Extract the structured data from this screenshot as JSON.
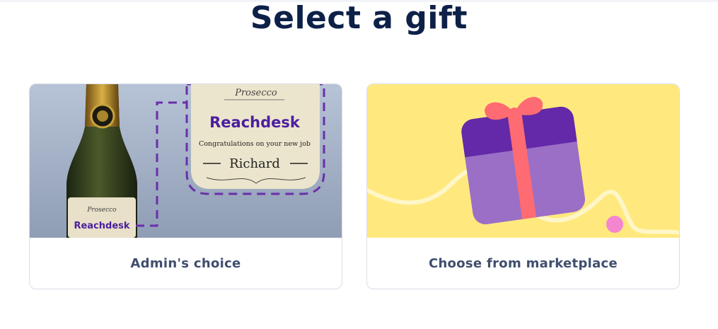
{
  "page": {
    "title": "Select a gift"
  },
  "cards": [
    {
      "label": "Admin's choice",
      "image": {
        "brand": "Reachdesk",
        "wine": "Prosecco",
        "message": "Congratulations on your new job",
        "name": "Richard"
      }
    },
    {
      "label": "Choose from marketplace",
      "image": {
        "icon": "gift-box-icon"
      }
    }
  ],
  "colors": {
    "title": "#0d2148",
    "label": "#3f4e6e",
    "accent_purple": "#6a2fa8",
    "marketplace_bg": "#ffe97f",
    "ribbon": "#ff6b72"
  }
}
